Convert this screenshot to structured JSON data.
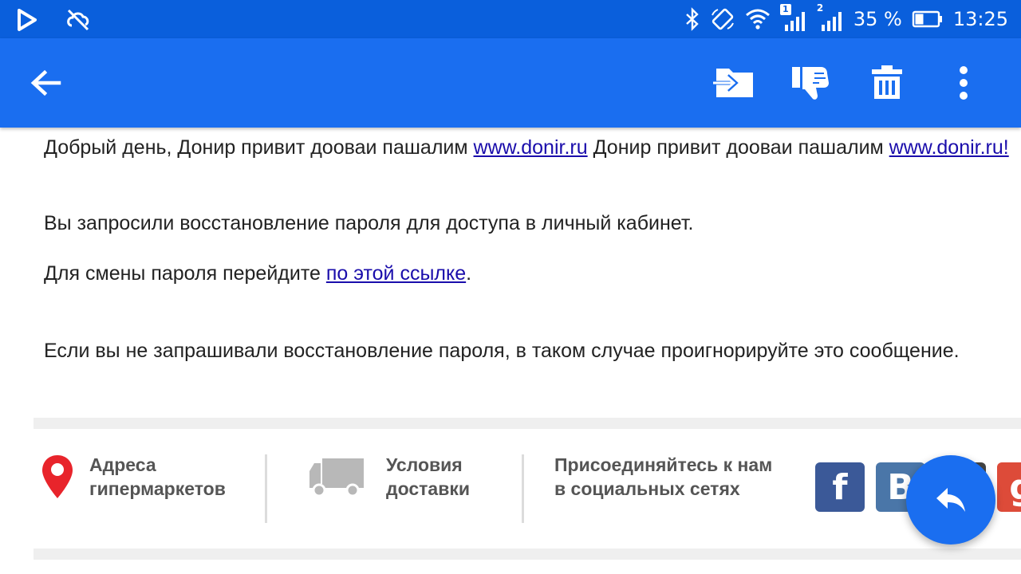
{
  "status_bar": {
    "icons_left": [
      "play-store-icon",
      "sync-disabled-icon"
    ],
    "icons_right": [
      "bluetooth-icon",
      "rotate-icon",
      "wifi-icon",
      "signal-sim1-icon",
      "signal-sim2-icon",
      "battery-icon"
    ],
    "sim1_label": "1",
    "sim2_label": "2",
    "battery": "35 %",
    "time": "13:25"
  },
  "app_bar": {
    "color": "#1a6ef0",
    "actions": [
      "move-to-folder-icon",
      "spam-icon",
      "delete-icon",
      "more-vert-icon"
    ]
  },
  "message": {
    "p1_text_a": "Добрый день, Донир привит дооваи пашалим ",
    "p1_link_a": "www.donir.ru",
    "p1_text_b": " Донир привит дооваи пашалим ",
    "p1_link_b": "www.donir.ru!",
    "p2": "Вы запросили восстановление пароля для доступа в личный кабинет.",
    "p3_text": "Для смены пароля перейдите ",
    "p3_link": "по этой ссылке",
    "p3_end": ".",
    "p4": "Если вы не запрашивали восстановление пароля, в таком случае проигнорируйте это сообщение."
  },
  "footer": {
    "addresses_line1": "Адреса",
    "addresses_line2": "гипермаркетов",
    "delivery_line1": "Условия",
    "delivery_line2": "доставки",
    "social_line1": "Присоединяйтесь к нам",
    "social_line2": "в социальных сетях",
    "social_buttons": [
      {
        "label": "f",
        "color": "#3b5998"
      },
      {
        "label": "B",
        "color": "#4a76a8"
      },
      {
        "label": "",
        "color": "#444444"
      },
      {
        "label": "g",
        "color": "#dd4b39"
      }
    ]
  },
  "fab": {
    "icon": "reply-icon"
  }
}
